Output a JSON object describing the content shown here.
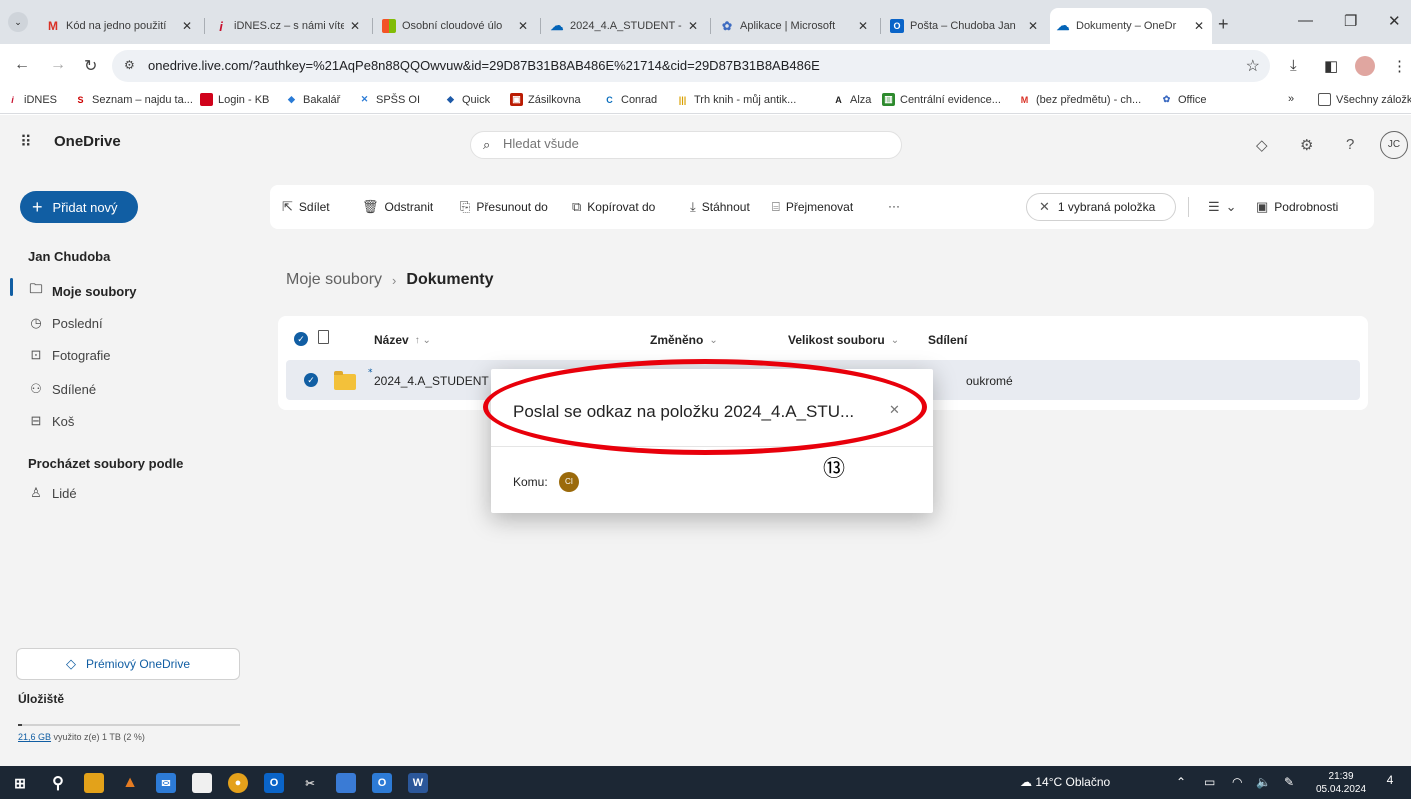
{
  "browser": {
    "tabs": [
      {
        "label": "Kód na jedno použití",
        "favicon": "gmail-icon",
        "color": "#d93025",
        "glyph": "M"
      },
      {
        "label": "iDNES.cz – s námi víte",
        "favicon": "idnes-icon",
        "color": "#c8102e",
        "glyph": "i"
      },
      {
        "label": "Osobní cloudové úlo",
        "favicon": "microsoft-icon",
        "color": "#f35325",
        "glyph": "■"
      },
      {
        "label": "2024_4.A_STUDENT -",
        "favicon": "onedrive-icon",
        "color": "#0364b8",
        "glyph": "☁"
      },
      {
        "label": "Aplikace | Microsoft",
        "favicon": "office-icon",
        "color": "#3d6bc1",
        "glyph": "✿"
      },
      {
        "label": "Pošta – Chudoba Jan",
        "favicon": "outlook-icon",
        "color": "#0a64c8",
        "glyph": "O"
      },
      {
        "label": "Dokumenty – OneDr",
        "favicon": "onedrive-icon",
        "color": "#0364b8",
        "glyph": "☁"
      }
    ],
    "url": "onedrive.live.com/?authkey=%21AqPe8n88QQOwvuw&id=29D87B31B8AB486E%21714&cid=29D87B31B8AB486E",
    "bookmarks": [
      {
        "label": "iDNES",
        "color": "#c8102e",
        "glyph": "i"
      },
      {
        "label": "Seznam – najdu ta...",
        "color": "#cc0000",
        "glyph": "S"
      },
      {
        "label": "Login - KB",
        "color": "#d0021b",
        "glyph": "▬"
      },
      {
        "label": "Bakalář",
        "color": "#2a7bd6",
        "glyph": "◆"
      },
      {
        "label": "SPŠS OI",
        "color": "#2a7bd6",
        "glyph": "✕"
      },
      {
        "label": "Quick",
        "color": "#1e5aa8",
        "glyph": "◆"
      },
      {
        "label": "Zásilkovna",
        "color": "#ba1b02",
        "glyph": "▣"
      },
      {
        "label": "Conrad",
        "color": "#0a6ebd",
        "glyph": "C"
      },
      {
        "label": "Trh knih - můj antik...",
        "color": "#d9a000",
        "glyph": "|||"
      },
      {
        "label": "Alza",
        "color": "#222",
        "glyph": "A"
      },
      {
        "label": "Centrální evidence...",
        "color": "#2d8a2d",
        "glyph": "▥"
      },
      {
        "label": "(bez předmětu) - ch...",
        "color": "#d93025",
        "glyph": "M"
      },
      {
        "label": "Office",
        "color": "#3d6bc1",
        "glyph": "✿"
      }
    ],
    "bookmarks_more": "»",
    "all_bookmarks": "Všechny záložky"
  },
  "onedrive": {
    "brand": "OneDrive",
    "search_placeholder": "Hledat všude",
    "add_new": "Přidat nový",
    "user": "Jan Chudoba",
    "avatar_initials": "JC",
    "nav": [
      {
        "label": "Moje soubory",
        "icon": "folder-icon"
      },
      {
        "label": "Poslední",
        "icon": "clock-icon"
      },
      {
        "label": "Fotografie",
        "icon": "image-icon"
      },
      {
        "label": "Sdílené",
        "icon": "people-icon"
      },
      {
        "label": "Koš",
        "icon": "trash-icon"
      }
    ],
    "browse_heading": "Procházet soubory podle",
    "browse_people": "Lidé",
    "premium": "Prémiový OneDrive",
    "storage_heading": "Úložiště",
    "storage_used": "21,6 GB",
    "storage_rest": "využito z(e) 1 TB (2 %)",
    "storage_fraction": 0.02,
    "commands": {
      "share": "Sdílet",
      "delete": "Odstranit",
      "move": "Přesunout do",
      "copy": "Kopírovat do",
      "download": "Stáhnout",
      "rename": "Přejmenovat",
      "more": "···",
      "selected": "1 vybraná položka",
      "details": "Podrobnosti"
    },
    "breadcrumb": {
      "root": "Moje soubory",
      "current": "Dokumenty"
    },
    "columns": {
      "name": "Název",
      "name_sort": "↑ ⌄",
      "modified": "Změněno",
      "size": "Velikost souboru",
      "sharing": "Sdílení"
    },
    "row": {
      "name": "2024_4.A_STUDENT",
      "sharing": "oukromé"
    }
  },
  "dialog": {
    "title": "Poslal se odkaz na položku 2024_4.A_STU...",
    "to_label": "Komu:",
    "recipient_initials": "CI"
  },
  "annotation": {
    "number": "⑬",
    "color": "#e8000b"
  },
  "taskbar": {
    "weather": "14°C Oblačno",
    "time": "21:39",
    "date": "05.04.2024",
    "notifications": "4"
  }
}
